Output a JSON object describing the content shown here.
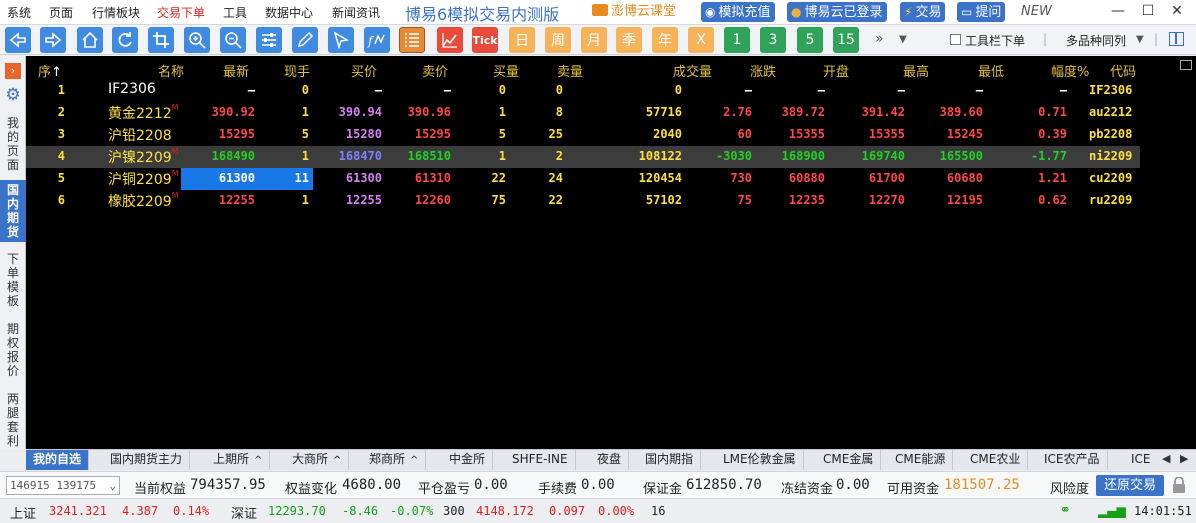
{
  "menu": {
    "items": [
      "系统",
      "页面",
      "行情板块",
      "交易下单",
      "工具",
      "数据中心",
      "新闻资讯"
    ],
    "active_item": "交易下单",
    "app_title": "博易6模拟交易内测版",
    "video_link": "澎博云课堂",
    "topup_button": "模拟充值",
    "cloud_login": "博易云已登录",
    "trade_button": "交易",
    "ask_button": "提问",
    "new_tag": "NEW"
  },
  "toolbar": {
    "period_buttons": [
      "日",
      "周",
      "月",
      "季",
      "年"
    ],
    "x_button": "X",
    "num_buttons": [
      "1",
      "3",
      "5",
      "15"
    ],
    "tick_label": "Tick",
    "toolbar_order_label": "工具栏下单",
    "multi_same_label": "多品种同列"
  },
  "side": {
    "items": [
      "我的页面",
      "国内期货",
      "下单模板",
      "期权报价",
      "两腿套利"
    ]
  },
  "grid": {
    "headers": [
      "序",
      "名称",
      "最新",
      "现手",
      "买价",
      "卖价",
      "买量",
      "卖量",
      "成交量",
      "涨跌",
      "开盘",
      "最高",
      "最低",
      "幅度%",
      "代码"
    ],
    "sort_icon": "↑",
    "rows": [
      {
        "seq": "1",
        "name": "IF2306",
        "mark": "",
        "last": "—",
        "vol_now": "0",
        "bid": "—",
        "ask": "—",
        "bid_q": "0",
        "ask_q": "0",
        "volume": "0",
        "chg": "—",
        "open": "—",
        "high": "—",
        "low": "—",
        "pct": "—",
        "code": "IF2306"
      },
      {
        "seq": "2",
        "name": "黄金2212",
        "mark": "M",
        "last": "390.92",
        "vol_now": "1",
        "bid": "390.94",
        "ask": "390.96",
        "bid_q": "1",
        "ask_q": "8",
        "volume": "57716",
        "chg": "2.76",
        "open": "389.72",
        "high": "391.42",
        "low": "389.60",
        "pct": "0.71",
        "code": "au2212"
      },
      {
        "seq": "3",
        "name": "沪铅2208",
        "mark": "",
        "last": "15295",
        "vol_now": "5",
        "bid": "15280",
        "ask": "15295",
        "bid_q": "5",
        "ask_q": "25",
        "volume": "2040",
        "chg": "60",
        "open": "15355",
        "high": "15355",
        "low": "15245",
        "pct": "0.39",
        "code": "pb2208"
      },
      {
        "seq": "4",
        "name": "沪镍2209",
        "mark": "M",
        "last": "168490",
        "vol_now": "1",
        "bid": "168470",
        "ask": "168510",
        "bid_q": "1",
        "ask_q": "2",
        "volume": "108122",
        "chg": "-3030",
        "open": "168900",
        "high": "169740",
        "low": "165500",
        "pct": "-1.77",
        "code": "ni2209"
      },
      {
        "seq": "5",
        "name": "沪铜2209",
        "mark": "M",
        "last": "61300",
        "vol_now": "11",
        "bid": "61300",
        "ask": "61310",
        "bid_q": "22",
        "ask_q": "24",
        "volume": "120454",
        "chg": "730",
        "open": "60880",
        "high": "61700",
        "low": "60680",
        "pct": "1.21",
        "code": "cu2209"
      },
      {
        "seq": "6",
        "name": "橡胶2209",
        "mark": "M",
        "last": "12255",
        "vol_now": "1",
        "bid": "12255",
        "ask": "12260",
        "bid_q": "75",
        "ask_q": "22",
        "volume": "57102",
        "chg": "75",
        "open": "12235",
        "high": "12270",
        "low": "12195",
        "pct": "0.62",
        "code": "ru2209"
      }
    ]
  },
  "tabs": [
    "我的自选",
    "国内期货主力",
    "上期所",
    "大商所",
    "郑商所",
    "中金所",
    "SHFE-INE",
    "夜盘",
    "国内期指",
    "LME伦敦金属",
    "CME金属",
    "CME能源",
    "CME农业",
    "ICE农产品",
    "ICE"
  ],
  "account": {
    "selector": "146915 139175",
    "equity_label": "当前权益",
    "equity": "794357.95",
    "equity_chg_label": "权益变化",
    "equity_chg": "4680.00",
    "close_pl_label": "平仓盈亏",
    "close_pl": "0.00",
    "fee_label": "手续费",
    "fee": "0.00",
    "margin_label": "保证金",
    "margin": "612850.70",
    "frozen_label": "冻结资金",
    "frozen": "0.00",
    "avail_label": "可用资金",
    "avail": "181507.25",
    "risk_label": "风险度",
    "restore_button": "还原交易"
  },
  "status": {
    "sh_label": "上证",
    "sh_val": "3241.321",
    "sh_chg": "4.387",
    "sh_pct": "0.14%",
    "sz_label": "深证",
    "sz_val": "12293.70",
    "sz_chg": "-8.46",
    "sz_pct": "-0.07%",
    "b300_label": "300",
    "b300_val": "4148.172",
    "b300_chg": "0.097",
    "b300_pct": "0.00%",
    "extra": "16",
    "time": "14:01:51"
  },
  "colors": {
    "accent": "#3a73c8",
    "up": "#ff4848",
    "down": "#24d024",
    "header": "#e0c040",
    "selected_cell": "#1878e8"
  }
}
